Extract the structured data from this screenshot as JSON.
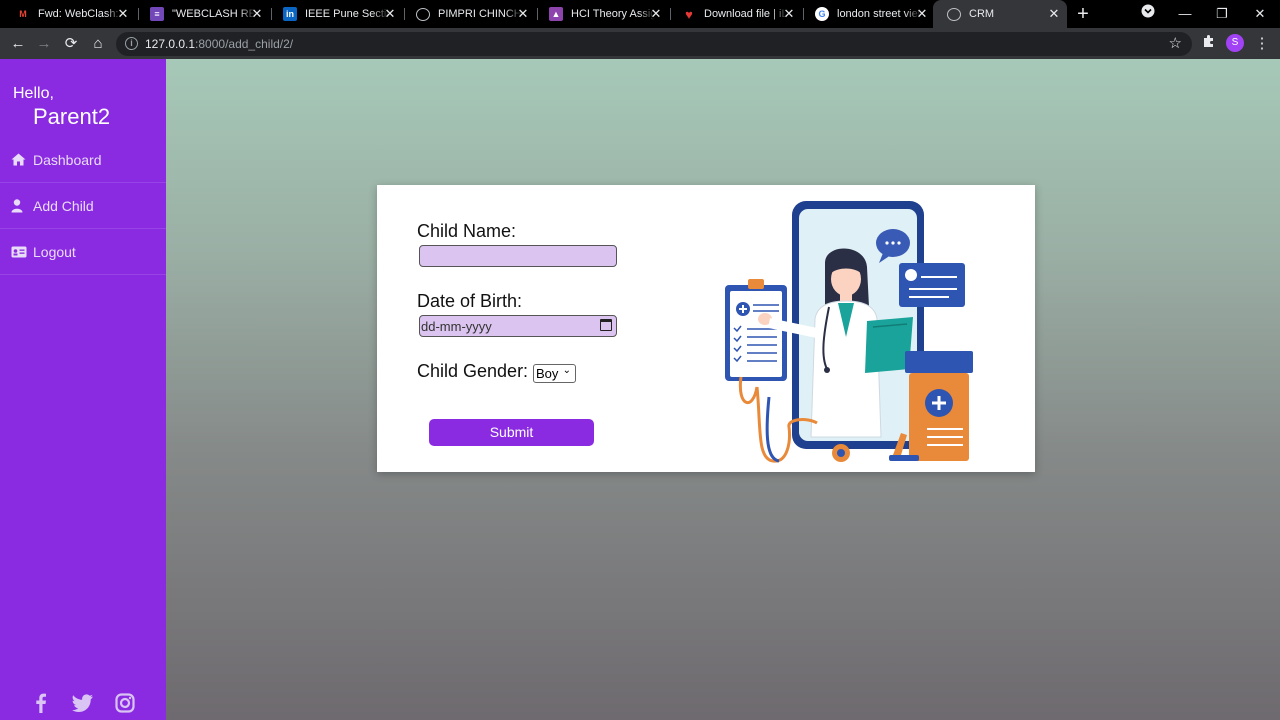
{
  "browser": {
    "tabs": [
      {
        "title": "Fwd: WebClash: Fi",
        "icon": "gmail-icon",
        "color": "#ea4335"
      },
      {
        "title": "\"WEBCLASH REGI",
        "icon": "forms-icon",
        "color": "#7248b9"
      },
      {
        "title": "IEEE Pune Section",
        "icon": "linkedin-icon",
        "color": "#0a66c2"
      },
      {
        "title": "PIMPRI CHINCHW",
        "icon": "globe-icon",
        "color": "#bdc1c6"
      },
      {
        "title": "HCI Theory Assign",
        "icon": "classroom-icon",
        "color": "#8e44ad"
      },
      {
        "title": "Download file | iL",
        "icon": "heart-icon",
        "color": "#e53935"
      },
      {
        "title": "london street view",
        "icon": "google-icon",
        "color": "#4285f4"
      },
      {
        "title": "CRM",
        "icon": "globe-icon",
        "color": "#bdc1c6"
      }
    ],
    "active_tab": 7,
    "url_host": "127.0.0.1",
    "url_rest": ":8000/add_child/2/",
    "profile_initial": "S"
  },
  "sidebar": {
    "greeting": "Hello,",
    "username": "Parent2",
    "items": [
      {
        "label": "Dashboard",
        "icon": "home-icon"
      },
      {
        "label": "Add Child",
        "icon": "user-icon"
      },
      {
        "label": "Logout",
        "icon": "id-card-icon"
      }
    ],
    "social": [
      "facebook-icon",
      "twitter-icon",
      "instagram-icon"
    ]
  },
  "form": {
    "child_name_label": "Child Name:",
    "child_name_value": "",
    "dob_label": "Date of Birth:",
    "dob_placeholder": "dd-mm-yyyy",
    "gender_label": "Child Gender:",
    "gender_selected": "Boy",
    "submit_label": "Submit"
  },
  "colors": {
    "accent": "#8a2be2",
    "input_bg": "#dbc4ef"
  }
}
